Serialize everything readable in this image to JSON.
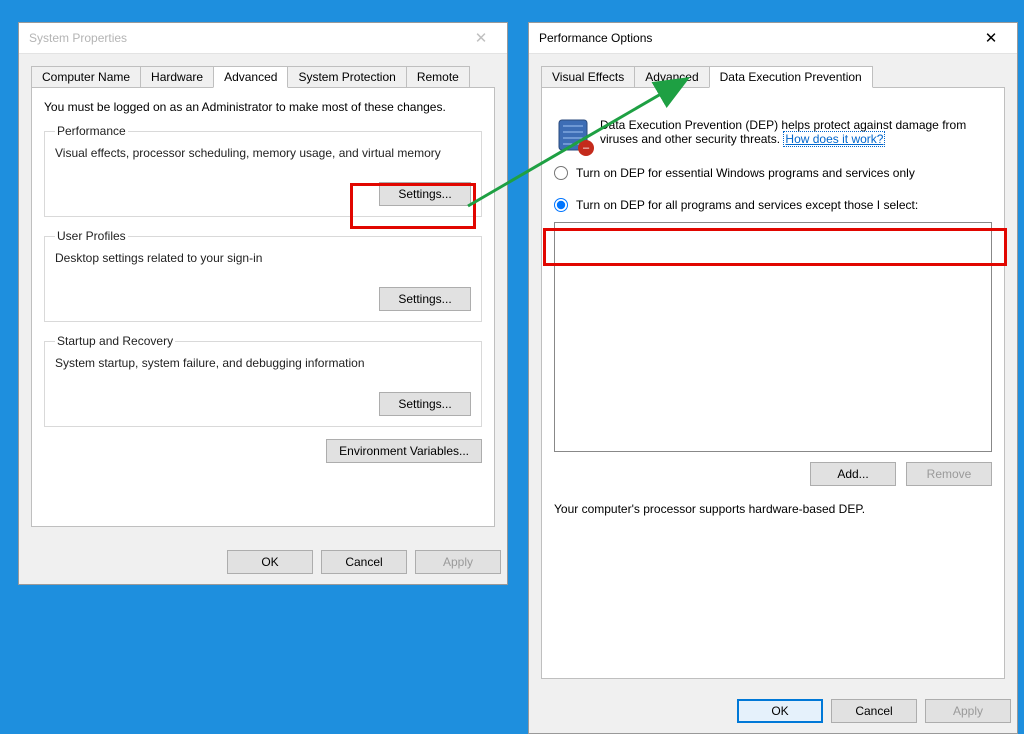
{
  "sysprops": {
    "title": "System Properties",
    "tabs": [
      "Computer Name",
      "Hardware",
      "Advanced",
      "System Protection",
      "Remote"
    ],
    "active_tab": 2,
    "admin_note": "You must be logged on as an Administrator to make most of these changes.",
    "groups": {
      "performance": {
        "legend": "Performance",
        "desc": "Visual effects, processor scheduling, memory usage, and virtual memory",
        "button": "Settings..."
      },
      "user_profiles": {
        "legend": "User Profiles",
        "desc": "Desktop settings related to your sign-in",
        "button": "Settings..."
      },
      "startup_recovery": {
        "legend": "Startup and Recovery",
        "desc": "System startup, system failure, and debugging information",
        "button": "Settings..."
      }
    },
    "env_vars_button": "Environment Variables...",
    "buttons": {
      "ok": "OK",
      "cancel": "Cancel",
      "apply": "Apply"
    }
  },
  "perfopts": {
    "title": "Performance Options",
    "tabs": [
      "Visual Effects",
      "Advanced",
      "Data Execution Prevention"
    ],
    "active_tab": 2,
    "dep_desc": "Data Execution Prevention (DEP) helps protect against damage from viruses and other security threats. ",
    "dep_link": "How does it work?",
    "radio_essential": "Turn on DEP for essential Windows programs and services only",
    "radio_all": "Turn on DEP for all programs and services except those I select:",
    "selected_radio": "all",
    "add": "Add...",
    "remove": "Remove",
    "support_note": "Your computer's processor supports hardware-based DEP.",
    "buttons": {
      "ok": "OK",
      "cancel": "Cancel",
      "apply": "Apply"
    }
  },
  "annotations": {
    "redbox_settings": true,
    "redbox_radio": true,
    "green_arrow": true
  }
}
